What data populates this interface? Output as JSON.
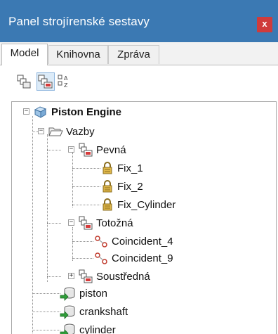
{
  "window": {
    "title": "Panel strojírenské sestavy",
    "close_label": "x"
  },
  "tabs": [
    {
      "label": "Model",
      "active": true
    },
    {
      "label": "Knihovna",
      "active": false
    },
    {
      "label": "Zpráva",
      "active": false
    }
  ],
  "toolbar": {
    "buttons": [
      {
        "icon": "constraint-group-icon",
        "pressed": false
      },
      {
        "icon": "constraint-group-red-icon",
        "pressed": true
      },
      {
        "icon": "sort-az-icon",
        "pressed": false
      }
    ]
  },
  "tree": {
    "root": "Piston Engine",
    "constraints_folder": "Vazby",
    "groups": [
      {
        "label": "Pevná",
        "items": [
          "Fix_1",
          "Fix_2",
          "Fix_Cylinder"
        ]
      },
      {
        "label": "Totožná",
        "items": [
          "Coincident_4",
          "Coincident_9"
        ]
      },
      {
        "label": "Soustředná",
        "items": []
      }
    ],
    "components": [
      "piston",
      "crankshaft",
      "cylinder"
    ]
  },
  "colors": {
    "titlebar": "#3b79b3",
    "close": "#cf3b3b",
    "selected_tool": "#dcebf8"
  }
}
